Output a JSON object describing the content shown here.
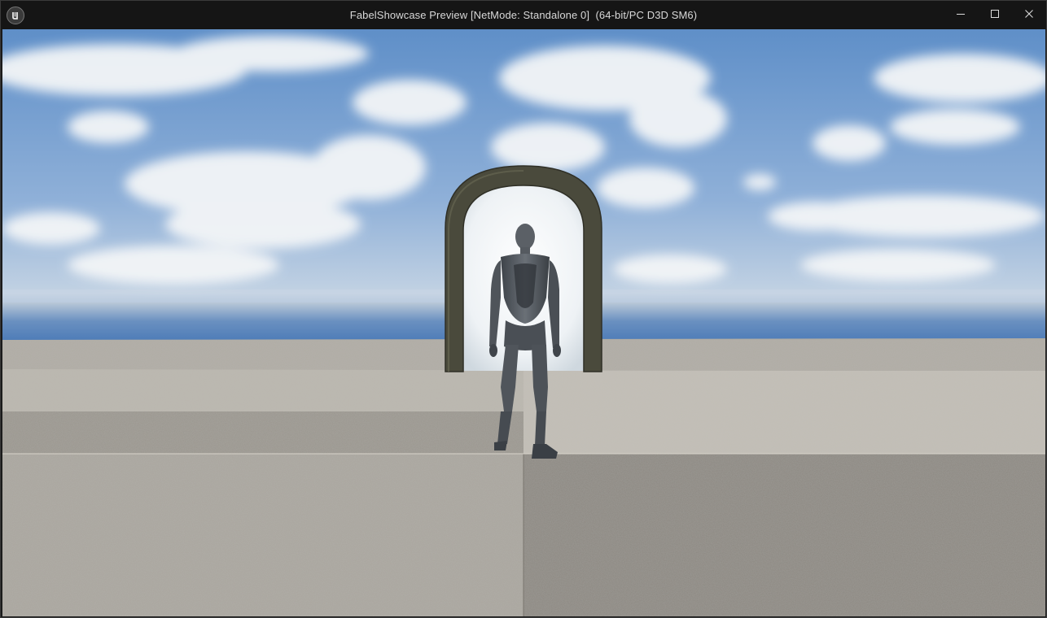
{
  "window": {
    "title": "FabelShowcase Preview [NetMode: Standalone 0]  (64-bit/PC D3D SM6)",
    "logo_icon": "unreal-engine-logo-icon",
    "controls": {
      "minimize_icon": "minimize-icon",
      "maximize_icon": "maximize-icon",
      "close_icon": "close-icon"
    }
  },
  "scene": {
    "sky_colors": [
      "#6d9ad0",
      "#c9d6e4"
    ],
    "ground_colors": [
      "#b5b0a6",
      "#8f8b84"
    ],
    "arch_color": "#4a4a3c",
    "character_color": "#5b6066"
  }
}
